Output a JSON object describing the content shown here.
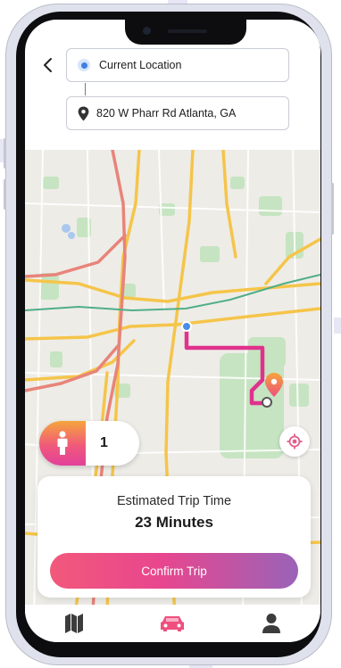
{
  "header": {
    "back_icon": "chevron-left-icon",
    "origin": {
      "label": "Current Location",
      "icon": "current-location-dot-icon"
    },
    "destination": {
      "label": "820 W Pharr Rd Atlanta, GA",
      "icon": "map-pin-icon"
    }
  },
  "map": {
    "colors": {
      "background": "#eeece7",
      "highway": "#f5c54a",
      "park": "#c6e4c1",
      "route": "#e0328d"
    }
  },
  "rider": {
    "count": "1",
    "icon": "person-icon",
    "badge_colors": [
      "#f5a53c",
      "#e2409a"
    ]
  },
  "locate_icon": "recenter-location-icon",
  "trip": {
    "label": "Estimated Trip Time",
    "time": "23 Minutes",
    "confirm_label": "Confirm Trip",
    "confirm_colors": [
      "#f2587b",
      "#9a63b8"
    ]
  },
  "nav": [
    {
      "icon": "map-icon",
      "active": false
    },
    {
      "icon": "car-icon",
      "active": true,
      "color": "#ef4f7e"
    },
    {
      "icon": "profile-icon",
      "active": false
    }
  ]
}
